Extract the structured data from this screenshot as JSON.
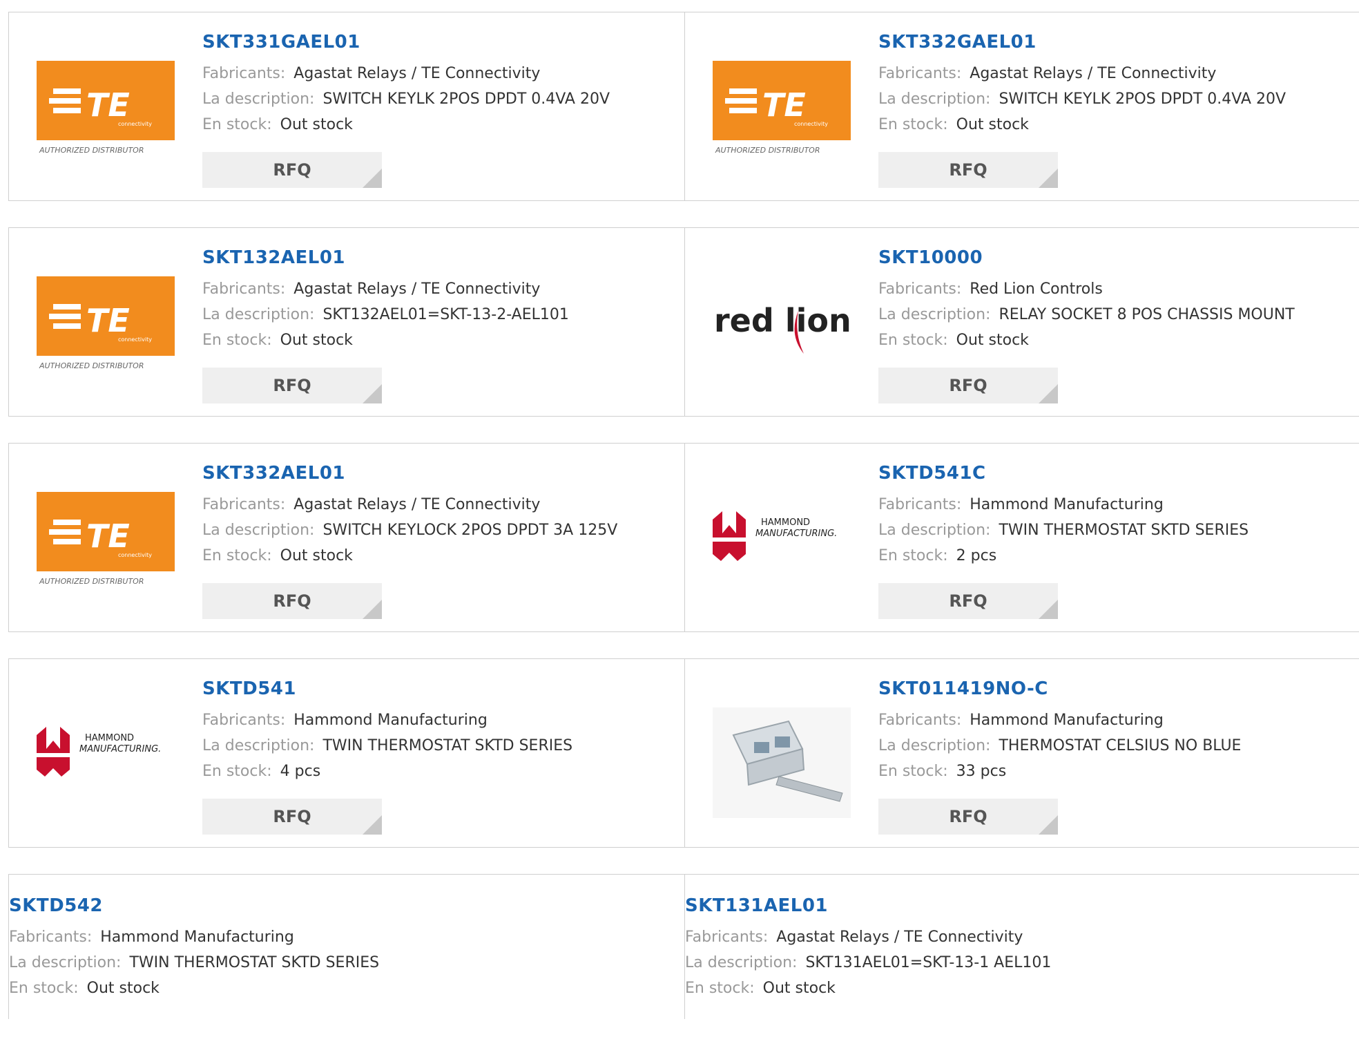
{
  "labels": {
    "manufacturer": "Fabricants:",
    "description": "La description:",
    "stock": "En stock:",
    "rfq": "RFQ"
  },
  "logos": {
    "te_caption": "AUTHORIZED DISTRIBUTOR",
    "te_sub": "connectivity",
    "te_text": "TE",
    "redlion_text": "red lion",
    "hammond_line1": "HAMMOND",
    "hammond_line2": "MANUFACTURING."
  },
  "products": [
    {
      "part": "SKT331GAEL01",
      "manufacturer": "Agastat Relays / TE Connectivity",
      "description": "SWITCH KEYLK 2POS DPDT 0.4VA 20V",
      "stock": "Out stock",
      "logo": "te-connectivity-logo"
    },
    {
      "part": "SKT332GAEL01",
      "manufacturer": "Agastat Relays / TE Connectivity",
      "description": "SWITCH KEYLK 2POS DPDT 0.4VA 20V",
      "stock": "Out stock",
      "logo": "te-connectivity-logo"
    },
    {
      "part": "SKT132AEL01",
      "manufacturer": "Agastat Relays / TE Connectivity",
      "description": "SKT132AEL01=SKT-13-2-AEL101",
      "stock": "Out stock",
      "logo": "te-connectivity-logo"
    },
    {
      "part": "SKT10000",
      "manufacturer": "Red Lion Controls",
      "description": "RELAY SOCKET 8 POS CHASSIS MOUNT",
      "stock": "Out stock",
      "logo": "red-lion-logo"
    },
    {
      "part": "SKT332AEL01",
      "manufacturer": "Agastat Relays / TE Connectivity",
      "description": "SWITCH KEYLOCK 2POS DPDT 3A 125V",
      "stock": "Out stock",
      "logo": "te-connectivity-logo"
    },
    {
      "part": "SKTD541C",
      "manufacturer": "Hammond Manufacturing",
      "description": "TWIN THERMOSTAT SKTD SERIES",
      "stock": "2 pcs",
      "logo": "hammond-logo"
    },
    {
      "part": "SKTD541",
      "manufacturer": "Hammond Manufacturing",
      "description": "TWIN THERMOSTAT SKTD SERIES",
      "stock": "4 pcs",
      "logo": "hammond-logo"
    },
    {
      "part": "SKT011419NO-C",
      "manufacturer": "Hammond Manufacturing",
      "description": "THERMOSTAT CELSIUS NO BLUE",
      "stock": "33 pcs",
      "logo": "thermostat-product-image"
    },
    {
      "part": "SKTD542",
      "manufacturer": "Hammond Manufacturing",
      "description": "TWIN THERMOSTAT SKTD SERIES",
      "stock": "Out stock",
      "logo": ""
    },
    {
      "part": "SKT131AEL01",
      "manufacturer": "Agastat Relays / TE Connectivity",
      "description": "SKT131AEL01=SKT-13-1 AEL101",
      "stock": "Out stock",
      "logo": ""
    }
  ],
  "colors": {
    "part_link": "#1a64b0",
    "te_orange": "#f28c1e",
    "redlion_red": "#c8102e",
    "hammond_red": "#c8102e"
  }
}
